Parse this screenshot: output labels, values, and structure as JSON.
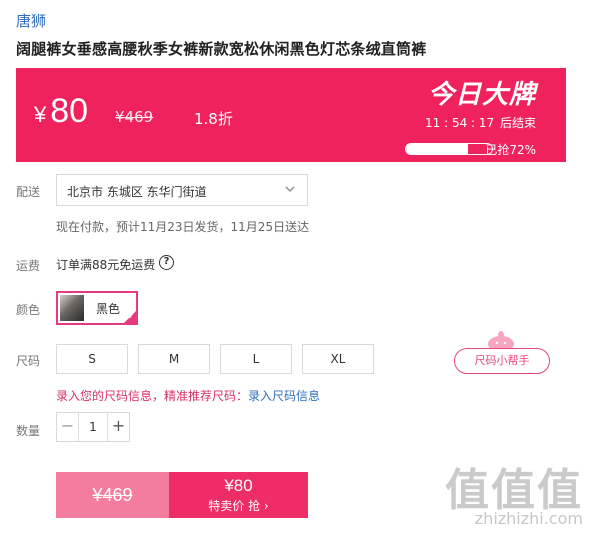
{
  "store": {
    "name": "唐狮"
  },
  "product": {
    "title": "阔腿裤女垂感高腰秋季女裤新款宽松休闲黑色灯芯条绒直筒裤"
  },
  "deal": {
    "currency": "¥",
    "price": "80",
    "original_price": "¥469",
    "discount": "1.8折",
    "badge": "今日大牌",
    "countdown": "11 : 54 : 17",
    "countdown_suffix": "后结束",
    "sold_percent": 72,
    "sold_text": "已抢72%",
    "accent_color": "#f0225d"
  },
  "delivery": {
    "label": "配送",
    "address": "北京市 东城区 东华门街道",
    "info": "现在付款，预计11月23日发货，11月25日送达"
  },
  "freight": {
    "label": "运费",
    "text": "订单满88元免运费",
    "help_icon": "?"
  },
  "color": {
    "label": "颜色",
    "selected": "黑色"
  },
  "size": {
    "label": "尺码",
    "options": [
      "S",
      "M",
      "L",
      "XL"
    ],
    "helper": "尺码小帮手",
    "tip": "录入您的尺码信息，精准推荐尺码：",
    "tip_link": "录入尺码信息"
  },
  "quantity": {
    "label": "数量",
    "value": "1",
    "minus": "−",
    "plus": "+"
  },
  "buy": {
    "original": "¥469",
    "price": "¥80",
    "label": "特卖价 抢 ›"
  },
  "watermark": {
    "text": "值值值",
    "url": "zhizhizhi.com"
  }
}
